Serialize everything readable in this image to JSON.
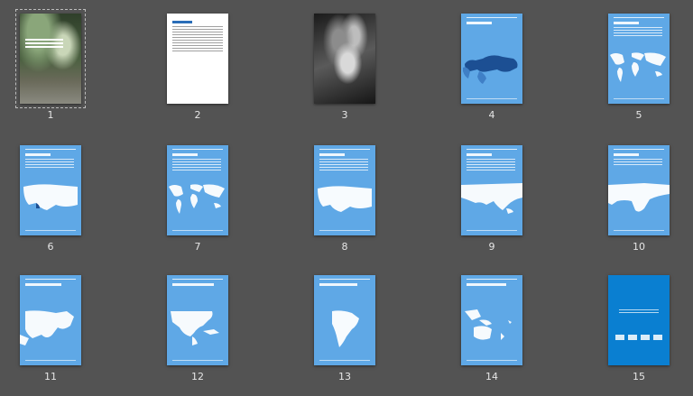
{
  "pages": [
    {
      "num": "1",
      "kind": "cover"
    },
    {
      "num": "2",
      "kind": "text"
    },
    {
      "num": "3",
      "kind": "photo"
    },
    {
      "num": "4",
      "kind": "map-eurasia"
    },
    {
      "num": "5",
      "kind": "map-world"
    },
    {
      "num": "6",
      "kind": "map-europe"
    },
    {
      "num": "7",
      "kind": "map-world"
    },
    {
      "num": "8",
      "kind": "map-europe"
    },
    {
      "num": "9",
      "kind": "map-asia"
    },
    {
      "num": "10",
      "kind": "map-africa"
    },
    {
      "num": "11",
      "kind": "map-middle-east"
    },
    {
      "num": "12",
      "kind": "map-north-america"
    },
    {
      "num": "13",
      "kind": "map-south-america"
    },
    {
      "num": "14",
      "kind": "map-oceania"
    },
    {
      "num": "15",
      "kind": "back-cover"
    }
  ],
  "colors": {
    "background": "#535353",
    "page_blue": "#5fa8e6",
    "back_cover_blue": "#0a7fd1",
    "page_number_text": "#e6e6e6"
  },
  "selected_page": "1"
}
